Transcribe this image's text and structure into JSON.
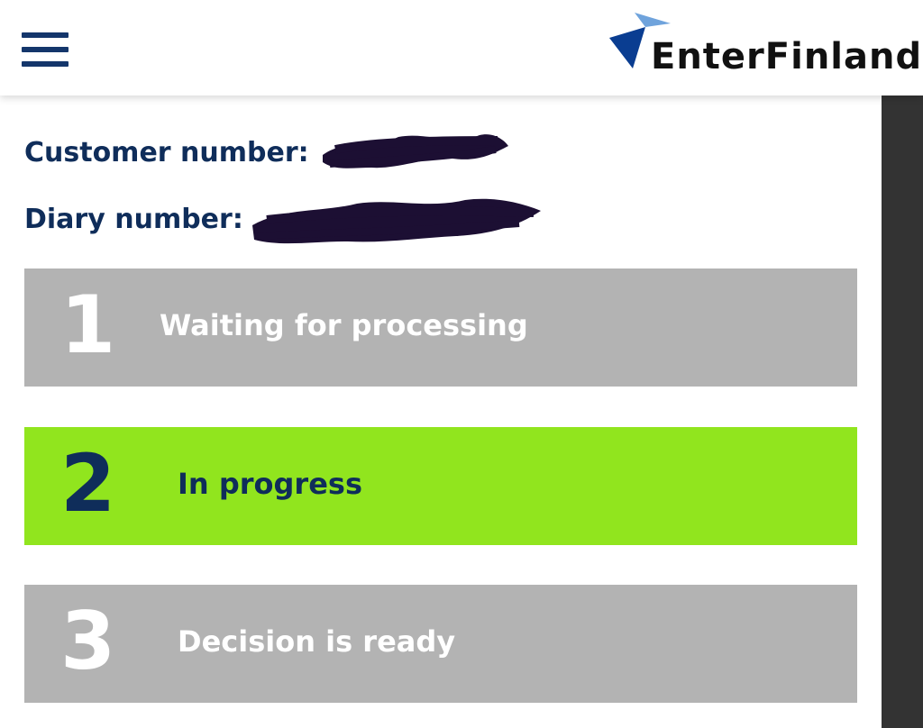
{
  "header": {
    "menu_icon": "hamburger-menu-icon",
    "logo_text": "EnterFinland",
    "logo_colors": {
      "triangle_dark": "#0a3d91",
      "triangle_light": "#6fa3dc"
    }
  },
  "info": {
    "customer_label": "Customer number:",
    "diary_label": "Diary number:"
  },
  "steps": [
    {
      "number": "1",
      "label": "Waiting for processing",
      "state": "inactive"
    },
    {
      "number": "2",
      "label": "In progress",
      "state": "active"
    },
    {
      "number": "3",
      "label": "Decision is ready",
      "state": "inactive"
    }
  ],
  "colors": {
    "inactive_bg": "#b3b3b3",
    "active_bg": "#91e51e",
    "inactive_text": "#ffffff",
    "active_text": "#0f2d5a",
    "redaction": "#1c0f33"
  }
}
